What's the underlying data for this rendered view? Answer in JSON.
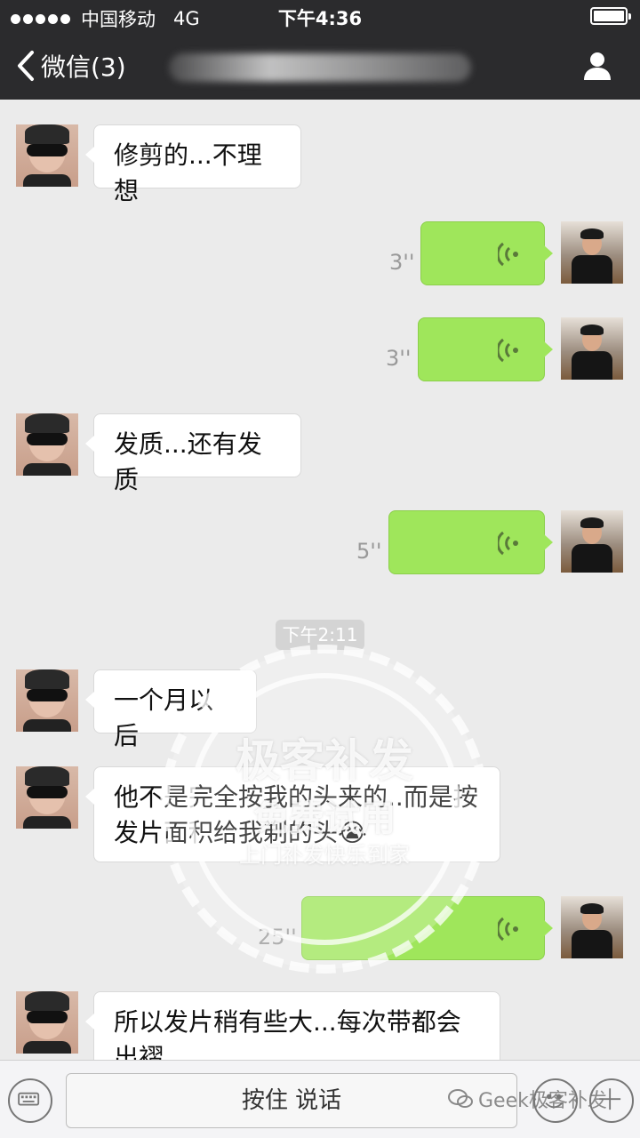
{
  "status_bar": {
    "carrier": "中国移动",
    "network": "4G",
    "time": "下午4:36"
  },
  "nav": {
    "back_label": "微信(3)"
  },
  "messages": [
    {
      "side": "left",
      "type": "text",
      "text": "修剪的...不理想"
    },
    {
      "side": "right",
      "type": "voice",
      "duration": "3''"
    },
    {
      "side": "right",
      "type": "voice",
      "duration": "3''"
    },
    {
      "side": "left",
      "type": "text",
      "text": "发质...还有发质"
    },
    {
      "side": "right",
      "type": "voice",
      "duration": "5''"
    },
    {
      "side": "left",
      "type": "text",
      "text": "一个月以后"
    },
    {
      "side": "left",
      "type": "text",
      "text": "他不是完全按我的头来的..而是按发片面积给我剃的头😭"
    },
    {
      "side": "right",
      "type": "voice",
      "duration": "25''"
    },
    {
      "side": "left",
      "type": "text",
      "text": "所以发片稍有些大...每次带都会出褶"
    }
  ],
  "timestamp": "下午2:11",
  "watermark": {
    "title": "极客补发",
    "subtitle": "免费试用",
    "tagline": "上门补发快乐到家"
  },
  "input_bar": {
    "talk_label": "按住 说话"
  },
  "footer_watermark": "Geek极客补发",
  "colors": {
    "nav_bg": "#2b2b2d",
    "chat_bg": "#ebebeb",
    "voice_bubble": "#9fe65b",
    "text_bubble": "#ffffff"
  }
}
